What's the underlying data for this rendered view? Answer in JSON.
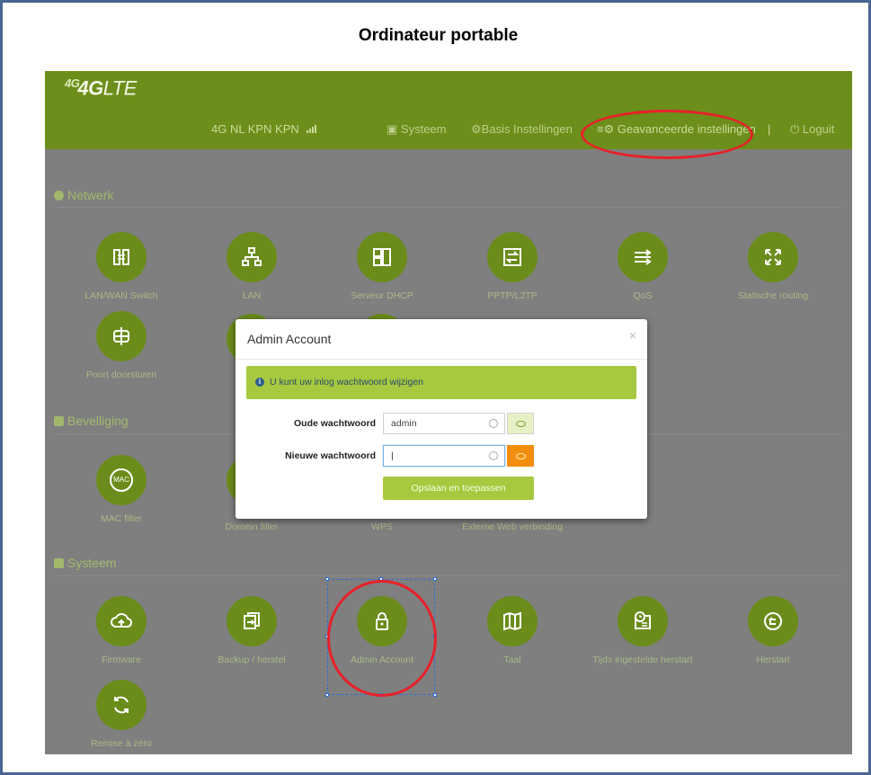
{
  "document": {
    "title": "Ordinateur portable"
  },
  "header": {
    "logo": {
      "sup": "4G",
      "main": "4G",
      "lte": "LTE"
    },
    "status": "4G  NL KPN KPN",
    "nav": {
      "system": "Systeem",
      "basic": "Basis Instellingen",
      "advanced": "Geavanceerde instellingen",
      "separator": "|",
      "logout": "Loguit"
    }
  },
  "sections": {
    "network": "Netwerk",
    "security": "Bevelliging",
    "system": "Systeem"
  },
  "network_tiles": [
    {
      "label": "LAN/WAN Switch",
      "icon": "switch-icon"
    },
    {
      "label": "LAN",
      "icon": "network-tree-icon"
    },
    {
      "label": "Serveur DHCP",
      "icon": "dhcp-icon"
    },
    {
      "label": "PPTP/L2TP",
      "icon": "tunnel-icon"
    },
    {
      "label": "QoS",
      "icon": "qos-icon"
    },
    {
      "label": "Statische routing",
      "icon": "routing-icon"
    },
    {
      "label": "Poort doorsturen",
      "icon": "port-forward-icon"
    }
  ],
  "security_tiles": [
    {
      "label": "MAC filter",
      "icon": "mac-icon",
      "badge": "MAC"
    },
    {
      "label": "Domein filter",
      "icon": "domain-icon"
    },
    {
      "label": "WPS",
      "icon": "wps-icon"
    },
    {
      "label": "Externe Web verbinding",
      "icon": "web-icon"
    }
  ],
  "system_tiles": [
    {
      "label": "Firmware",
      "icon": "cloud-upload-icon"
    },
    {
      "label": "Backup / herstel",
      "icon": "backup-icon"
    },
    {
      "label": "Admin Account",
      "icon": "lock-icon"
    },
    {
      "label": "Taal",
      "icon": "map-icon"
    },
    {
      "label": "Tijds ingestelde herstart",
      "icon": "schedule-icon"
    },
    {
      "label": "Herstart",
      "icon": "restart-icon"
    },
    {
      "label": "Remise à zéro",
      "icon": "reset-icon"
    }
  ],
  "modal": {
    "title": "Admin Account",
    "close": "×",
    "alert": "U kunt uw inlog wachtwoord wijzigen",
    "old_password_label": "Oude wachtwoord",
    "old_password_value": "admin",
    "new_password_label": "Nieuwe wachtwoord",
    "new_password_value": "",
    "save_button": "Opslaan en toepassen"
  },
  "colors": {
    "header": "#6c8e1b",
    "accent": "#a6c93f",
    "orange": "#f38d0d",
    "annotation": "#e8202a"
  }
}
